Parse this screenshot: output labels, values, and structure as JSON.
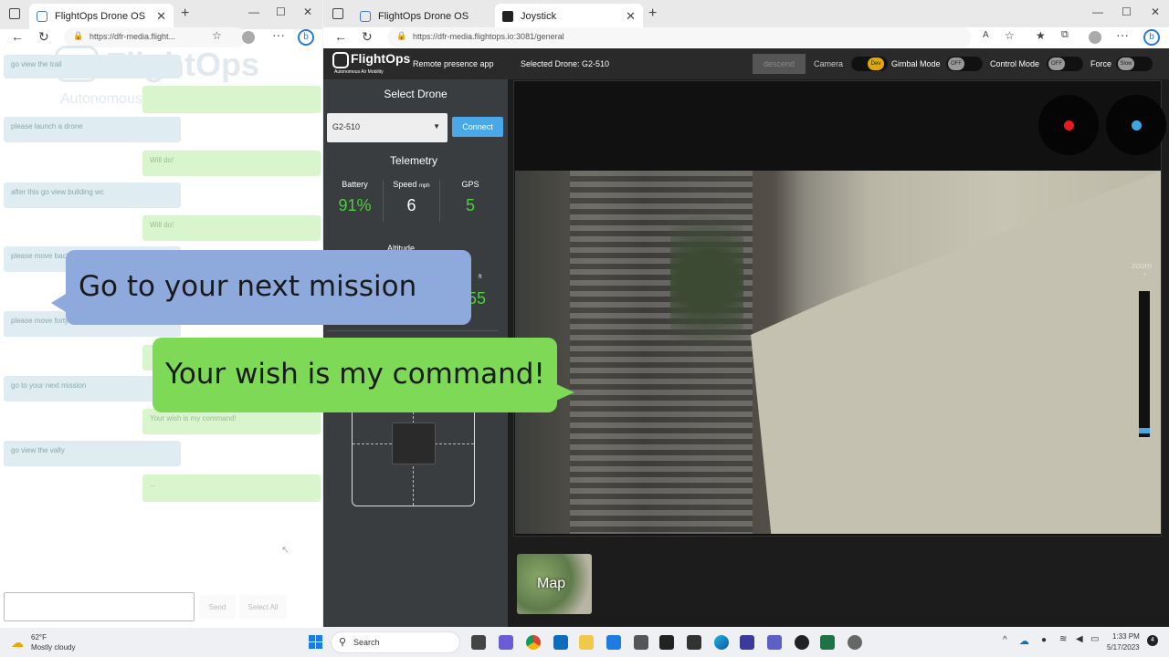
{
  "left_window": {
    "tab_title": "FlightOps Drone OS",
    "url": "https://dfr-media.flight...",
    "logo_text": "FlightOps",
    "logo_subtitle": "Autonomous Air Mobility",
    "chat": [
      {
        "side": "user",
        "text": "go view the trail"
      },
      {
        "side": "user",
        "text": "please launch a drone"
      },
      {
        "side": "bot",
        "text": "Will do!"
      },
      {
        "side": "user",
        "text": "after this go view building wc"
      },
      {
        "side": "bot",
        "text": "Will do!"
      },
      {
        "side": "user",
        "text": "please move back"
      },
      {
        "side": "user",
        "text": "please move forty m"
      },
      {
        "side": "user",
        "text": "go to your next mission"
      },
      {
        "side": "bot",
        "text": "Your wish is my command!"
      },
      {
        "side": "user",
        "text": "go view the vally"
      },
      {
        "side": "bot",
        "text": "..."
      }
    ],
    "input_placeholder": "",
    "send_label": "Send",
    "select_all_label": "Select All"
  },
  "right_window": {
    "tab1_title": "FlightOps Drone OS",
    "tab2_title": "Joystick",
    "url": "https://dfr-media.flightops.io:3081/general"
  },
  "app": {
    "logo_text": "FlightOps",
    "logo_subtitle": "Autonomous Air Mobility",
    "app_name": "Remote presence app",
    "selected_drone_label": "Selected Drone: G2-510",
    "descend_label": "descend",
    "camera_label": "Camera",
    "camera_toggle": "Dev",
    "gimbal_label": "Gimbal Mode",
    "gimbal_toggle": "OFF",
    "control_label": "Control Mode",
    "control_toggle": "OFF",
    "force_label": "Force",
    "force_toggle": "Slow",
    "select_drone_title": "Select Drone",
    "drone_option": "G2-510",
    "connect_label": "Connect",
    "telemetry_title": "Telemetry",
    "battery_label": "Battery",
    "battery_value": "91%",
    "speed_label": "Speed",
    "speed_unit": "mph",
    "speed_value": "6",
    "gps_label": "GPS",
    "gps_value": "5",
    "altitude_label": "Altitude",
    "altitude_unit": "ft",
    "altitude_value": "55",
    "zoom_label": "zoom",
    "zoom_plus": "+",
    "zoom_minus": "-",
    "map_label": "Map"
  },
  "callouts": {
    "user": "Go to your next mission",
    "bot": "Your wish is my command!"
  },
  "taskbar": {
    "weather_temp": "62°F",
    "weather_desc": "Mostly cloudy",
    "search_label": "Search",
    "time": "1:33 PM",
    "date": "5/17/2023"
  },
  "colors": {
    "accent_green": "#4cd137",
    "connect_blue": "#4aa8e8",
    "callout_blue": "#8ea9dc",
    "callout_green": "#7ed957"
  }
}
